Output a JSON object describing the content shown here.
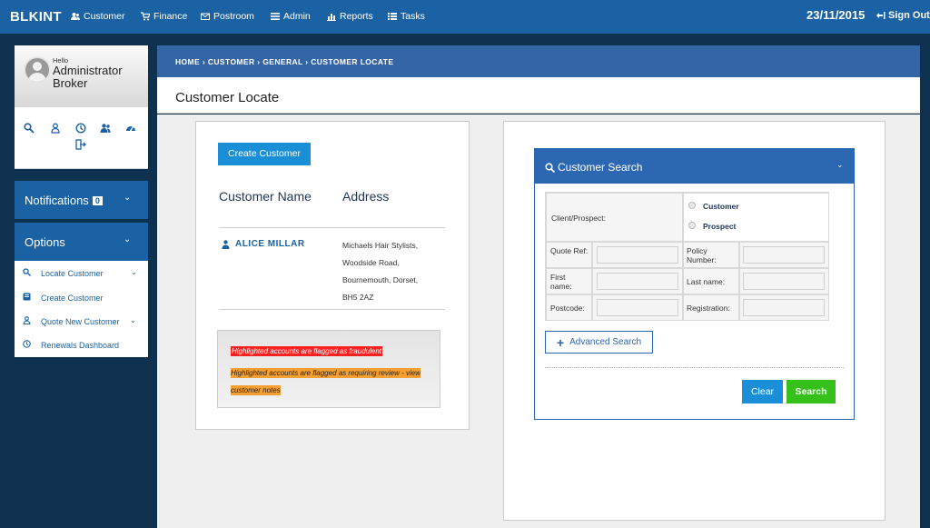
{
  "topnav": {
    "brand": "BLKINT",
    "items": [
      {
        "label": "Customer",
        "icon": "users-icon"
      },
      {
        "label": "Finance",
        "icon": "cart-icon"
      },
      {
        "label": "Postroom",
        "icon": "envelope-icon"
      },
      {
        "label": "Admin",
        "icon": "list-icon"
      },
      {
        "label": "Reports",
        "icon": "bar-chart-icon"
      },
      {
        "label": "Tasks",
        "icon": "tasks-icon"
      }
    ],
    "date": "23/11/2015",
    "signout": "Sign Out"
  },
  "sidebar": {
    "hello": "Hello",
    "user_name": "Administrator",
    "user_role": "Broker",
    "quick_icons": [
      "search-icon",
      "user-icon",
      "clock-icon",
      "users-icon",
      "dashboard-icon",
      "sign-out-icon"
    ],
    "notifications": {
      "label": "Notifications",
      "count": "0"
    },
    "options_label": "Options",
    "options": [
      {
        "label": "Locate Customer",
        "icon": "search-icon",
        "has_chevron": true
      },
      {
        "label": "Create Customer",
        "icon": "id-card-icon",
        "has_chevron": false
      },
      {
        "label": "Quote New Customer",
        "icon": "user-icon",
        "has_chevron": true
      },
      {
        "label": "Renewals Dashboard",
        "icon": "clock-icon",
        "has_chevron": false
      }
    ]
  },
  "breadcrumb": "HOME › CUSTOMER › GENERAL › CUSTOMER LOCATE",
  "page_title": "Customer Locate",
  "results": {
    "create_button": "Create Customer",
    "col_name": "Customer Name",
    "col_address": "Address",
    "rows": [
      {
        "name": "ALICE MILLAR",
        "address_lines": [
          "Michaels Hair Stylists,",
          "Woodside Road,",
          "Bournemouth, Dorset,",
          "BH5 2AZ"
        ]
      }
    ],
    "legend_fraud": "Highlighted accounts are flagged as fraudulent",
    "legend_review": "Highlighted accounts are flagged as requiring review - view customer notes"
  },
  "search": {
    "title": "Customer Search",
    "client_prospect_label": "Client/Prospect:",
    "radio_customer": "Customer",
    "radio_prospect": "Prospect",
    "quote_ref_label": "Quote Ref:",
    "policy_number_label": "Policy Number:",
    "first_name_label": "First name:",
    "last_name_label": "Last name:",
    "postcode_label": "Postcode:",
    "registration_label": "Registration:",
    "advanced_search": "Advanced Search",
    "clear": "Clear",
    "search": "Search"
  },
  "colors": {
    "nav_blue": "#1a62a3",
    "breadcrumb_blue": "#3465a4",
    "button_blue": "#1a8fd8",
    "search_green": "#35c01c",
    "fraud_red": "#ff2020",
    "review_orange": "#f5a030"
  }
}
